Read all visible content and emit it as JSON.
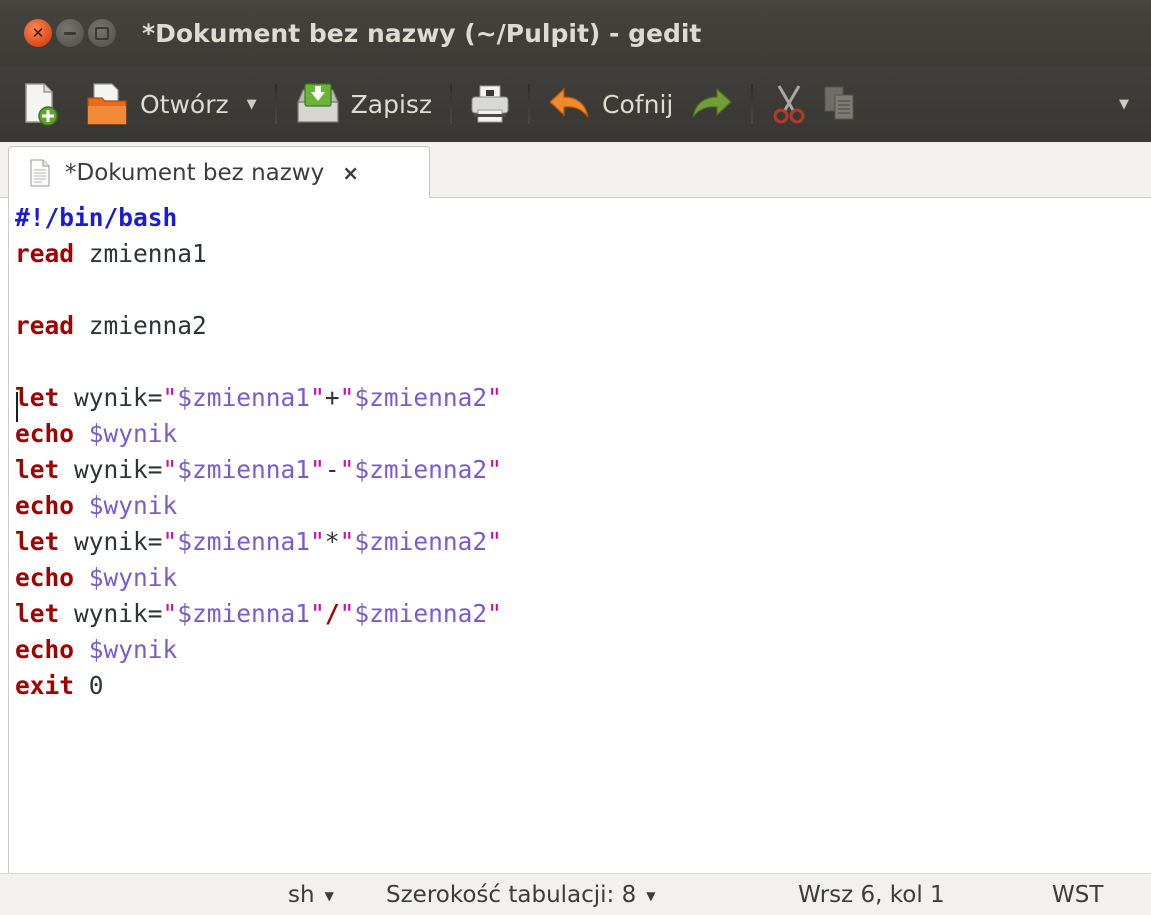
{
  "window": {
    "title": "*Dokument bez nazwy (~/Pulpit) - gedit"
  },
  "toolbar": {
    "new_icon": "new-document-icon",
    "open_label": "Otwórz",
    "save_label": "Zapisz",
    "print_icon": "print-icon",
    "undo_label": "Cofnij",
    "redo_icon": "redo-arrow-icon",
    "cut_icon": "scissors-icon",
    "copy_icon": "copy-icon",
    "overflow_icon": "chevron-down-icon"
  },
  "tab": {
    "label": "*Dokument bez nazwy",
    "close": "×"
  },
  "editor": {
    "lines": [
      [
        {
          "t": "#!/bin/bash",
          "c": "shebang"
        }
      ],
      [
        {
          "t": "read",
          "c": "kw"
        },
        {
          "t": " zmienna1",
          "c": "plain"
        }
      ],
      [],
      [
        {
          "t": "read",
          "c": "kw"
        },
        {
          "t": " zmienna2",
          "c": "plain"
        }
      ],
      [],
      [
        {
          "t": "let",
          "c": "kw"
        },
        {
          "t": " wynik=",
          "c": "plain"
        },
        {
          "t": "\"",
          "c": "str"
        },
        {
          "t": "$zmienna1",
          "c": "var"
        },
        {
          "t": "\"",
          "c": "str"
        },
        {
          "t": "+",
          "c": "plain"
        },
        {
          "t": "\"",
          "c": "str"
        },
        {
          "t": "$zmienna2",
          "c": "var"
        },
        {
          "t": "\"",
          "c": "str"
        }
      ],
      [
        {
          "t": "echo",
          "c": "kw"
        },
        {
          "t": " ",
          "c": "plain"
        },
        {
          "t": "$wynik",
          "c": "var"
        }
      ],
      [
        {
          "t": "let",
          "c": "kw"
        },
        {
          "t": " wynik=",
          "c": "plain"
        },
        {
          "t": "\"",
          "c": "str"
        },
        {
          "t": "$zmienna1",
          "c": "var"
        },
        {
          "t": "\"",
          "c": "str"
        },
        {
          "t": "-",
          "c": "plain"
        },
        {
          "t": "\"",
          "c": "str"
        },
        {
          "t": "$zmienna2",
          "c": "var"
        },
        {
          "t": "\"",
          "c": "str"
        }
      ],
      [
        {
          "t": "echo",
          "c": "kw"
        },
        {
          "t": " ",
          "c": "plain"
        },
        {
          "t": "$wynik",
          "c": "var"
        }
      ],
      [
        {
          "t": "let",
          "c": "kw"
        },
        {
          "t": " wynik=",
          "c": "plain"
        },
        {
          "t": "\"",
          "c": "str"
        },
        {
          "t": "$zmienna1",
          "c": "var"
        },
        {
          "t": "\"",
          "c": "str"
        },
        {
          "t": "*",
          "c": "plain"
        },
        {
          "t": "\"",
          "c": "str"
        },
        {
          "t": "$zmienna2",
          "c": "var"
        },
        {
          "t": "\"",
          "c": "str"
        }
      ],
      [
        {
          "t": "echo",
          "c": "kw"
        },
        {
          "t": " ",
          "c": "plain"
        },
        {
          "t": "$wynik",
          "c": "var"
        }
      ],
      [
        {
          "t": "let",
          "c": "kw"
        },
        {
          "t": " wynik=",
          "c": "plain"
        },
        {
          "t": "\"",
          "c": "str"
        },
        {
          "t": "$zmienna1",
          "c": "var"
        },
        {
          "t": "\"",
          "c": "str"
        },
        {
          "t": "/",
          "c": "op-bold"
        },
        {
          "t": "\"",
          "c": "str"
        },
        {
          "t": "$zmienna2",
          "c": "var"
        },
        {
          "t": "\"",
          "c": "str"
        }
      ],
      [
        {
          "t": "echo",
          "c": "kw"
        },
        {
          "t": " ",
          "c": "plain"
        },
        {
          "t": "$wynik",
          "c": "var"
        }
      ],
      [
        {
          "t": "exit",
          "c": "kw"
        },
        {
          "t": " 0",
          "c": "plain"
        }
      ]
    ]
  },
  "statusbar": {
    "language": "sh",
    "tab_width": "Szerokość tabulacji: 8",
    "position": "Wrsz 6, kol 1",
    "mode": "WST"
  },
  "colors": {
    "titlebar": "#3c3b37",
    "close_button": "#df4a16",
    "keyword": "#a40000",
    "shebang": "#1a1add",
    "string_quote": "#d300ae",
    "variable": "#7a5bcf"
  }
}
